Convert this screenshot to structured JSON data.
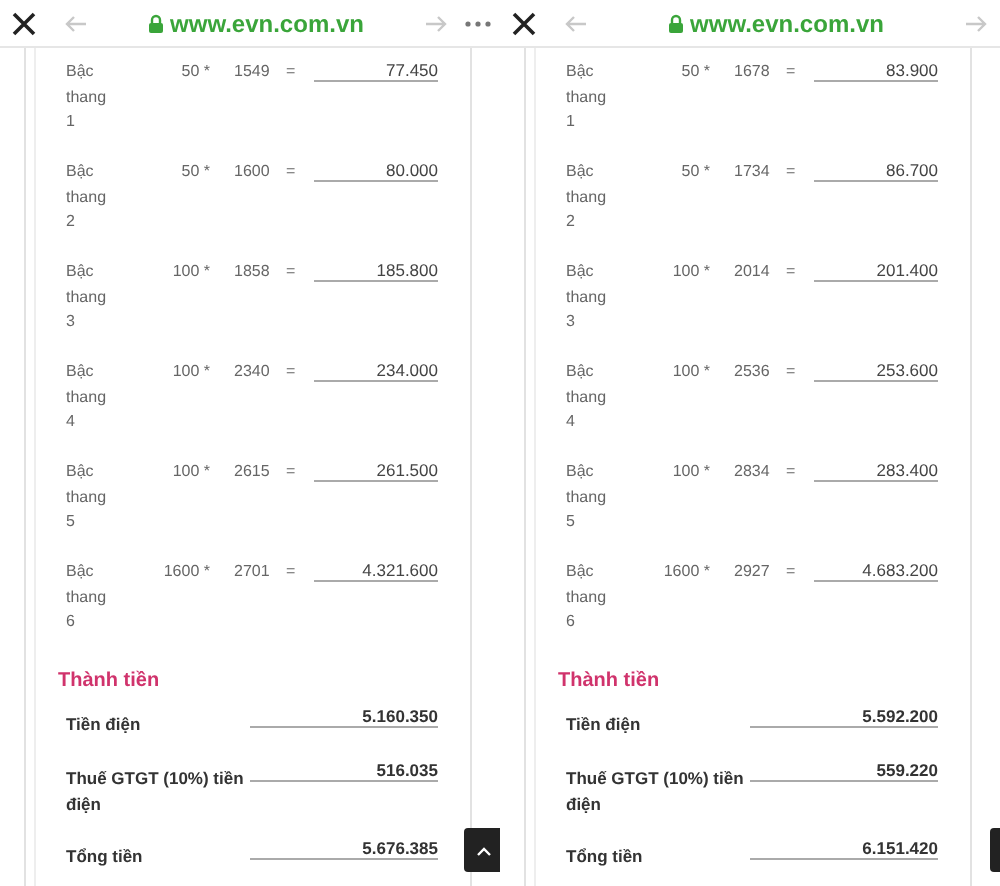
{
  "panels": [
    {
      "url": "www.evn.com.vn",
      "more_menu": true,
      "rows": [
        {
          "label": "Bậc thang 1",
          "qty": "50 *",
          "price": "1549",
          "eq": "=",
          "amount": "77.450"
        },
        {
          "label": "Bậc thang 2",
          "qty": "50 *",
          "price": "1600",
          "eq": "=",
          "amount": "80.000"
        },
        {
          "label": "Bậc thang 3",
          "qty": "100 *",
          "price": "1858",
          "eq": "=",
          "amount": "185.800"
        },
        {
          "label": "Bậc thang 4",
          "qty": "100 *",
          "price": "2340",
          "eq": "=",
          "amount": "234.000"
        },
        {
          "label": "Bậc thang 5",
          "qty": "100 *",
          "price": "2615",
          "eq": "=",
          "amount": "261.500"
        },
        {
          "label": "Bậc thang 6",
          "qty": "1600 *",
          "price": "2701",
          "eq": "=",
          "amount": "4.321.600"
        }
      ],
      "summary_title": "Thành tiền",
      "summary": [
        {
          "label": "Tiền điện",
          "value": "5.160.350"
        },
        {
          "label": "Thuế GTGT (10%) tiền điện",
          "value": "516.035"
        },
        {
          "label": "Tổng tiền",
          "value": "5.676.385"
        }
      ]
    },
    {
      "url": "www.evn.com.vn",
      "more_menu": false,
      "rows": [
        {
          "label": "Bậc thang 1",
          "qty": "50 *",
          "price": "1678",
          "eq": "=",
          "amount": "83.900"
        },
        {
          "label": "Bậc thang 2",
          "qty": "50 *",
          "price": "1734",
          "eq": "=",
          "amount": "86.700"
        },
        {
          "label": "Bậc thang 3",
          "qty": "100 *",
          "price": "2014",
          "eq": "=",
          "amount": "201.400"
        },
        {
          "label": "Bậc thang 4",
          "qty": "100 *",
          "price": "2536",
          "eq": "=",
          "amount": "253.600"
        },
        {
          "label": "Bậc thang 5",
          "qty": "100 *",
          "price": "2834",
          "eq": "=",
          "amount": "283.400"
        },
        {
          "label": "Bậc thang 6",
          "qty": "1600 *",
          "price": "2927",
          "eq": "=",
          "amount": "4.683.200"
        }
      ],
      "summary_title": "Thành tiền",
      "summary": [
        {
          "label": "Tiền điện",
          "value": "5.592.200"
        },
        {
          "label": "Thuế GTGT (10%) tiền điện",
          "value": "559.220"
        },
        {
          "label": "Tổng tiền",
          "value": "6.151.420"
        }
      ]
    }
  ]
}
